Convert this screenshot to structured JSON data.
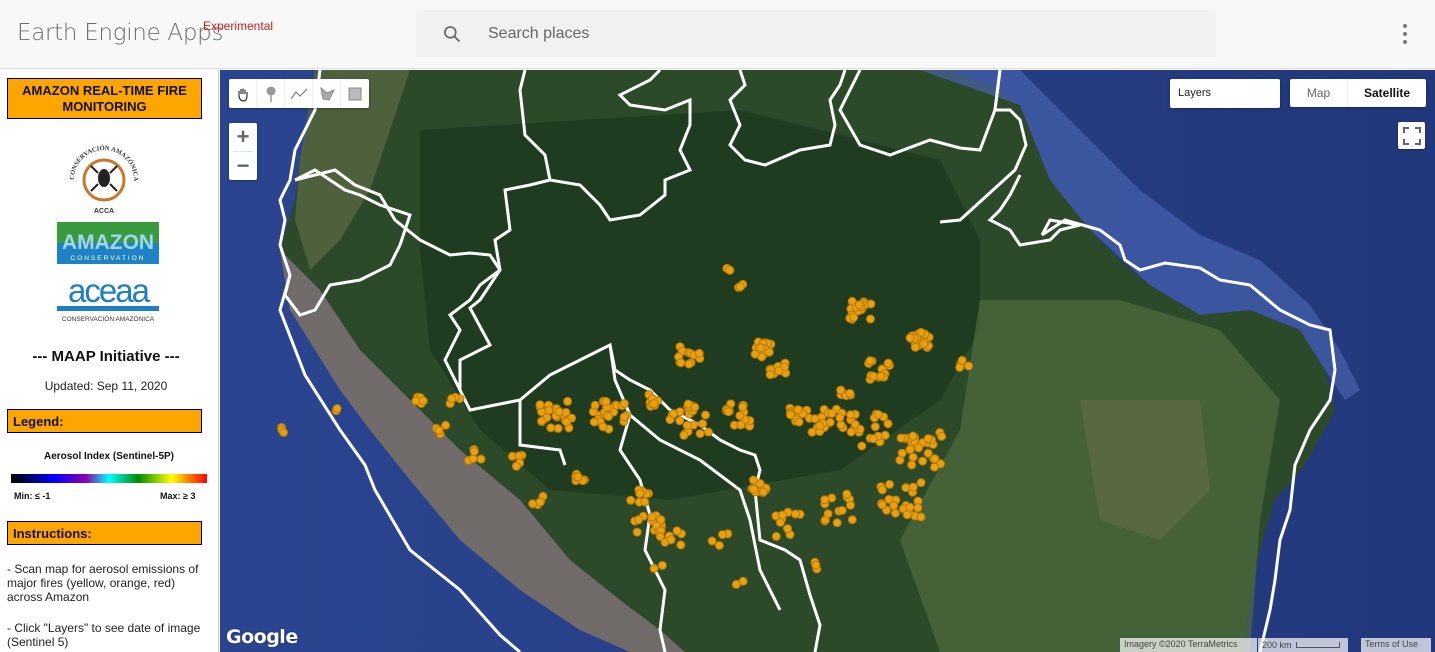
{
  "header": {
    "app_title": "Earth Engine Apps",
    "badge": "Experimental",
    "search_placeholder": "Search places",
    "search_value": "",
    "icons": {
      "search": "search-icon",
      "menu": "more-vert-icon"
    }
  },
  "side_panel": {
    "title": "AMAZON REAL-TIME FIRE MONITORING",
    "logos": [
      {
        "name": "ACCA",
        "arc_text": "CONSERVACIÓN AMAZÓNICA",
        "caption": "ACCA"
      },
      {
        "name": "AMAZON",
        "sub": "CONSERVATION"
      },
      {
        "name": "aceaa",
        "sub": "CONSERVACIÓN AMAZÓNICA"
      }
    ],
    "initiative": "--- MAAP Initiative ---",
    "updated": "Updated: Sep 11, 2020",
    "legend_header": "Legend:",
    "legend_title": "Aerosol Index (Sentinel-5P)",
    "legend_min": "Min: ≤ -1",
    "legend_max": "Max: ≥ 3",
    "legend_palette": [
      "#000000",
      "#000088",
      "#0000ff",
      "#8800aa",
      "#00ffff",
      "#008800",
      "#88cc00",
      "#ffff00",
      "#ff8800",
      "#ff0000"
    ],
    "instructions_header": "Instructions:",
    "instructions": [
      "- Scan map for aerosol emissions of major fires (yellow, orange, red) across Amazon",
      "- Click \"Layers\" to see date of image (Sentinel 5)"
    ]
  },
  "map": {
    "draw_tools": [
      {
        "name": "pan-hand-icon"
      },
      {
        "name": "point-marker-icon"
      },
      {
        "name": "line-icon"
      },
      {
        "name": "polygon-icon"
      },
      {
        "name": "rectangle-icon"
      }
    ],
    "zoom_in": "+",
    "zoom_out": "−",
    "layers_label": "Layers",
    "map_type": {
      "map": "Map",
      "satellite": "Satellite",
      "selected": "Satellite"
    },
    "google_logo": "Google",
    "attribution": "Imagery ©2020 TerraMetrics",
    "scale_label": "200 km",
    "terms": "Terms of Use",
    "fire_color": "#e8a010",
    "boundary_color": "#ffffff"
  }
}
